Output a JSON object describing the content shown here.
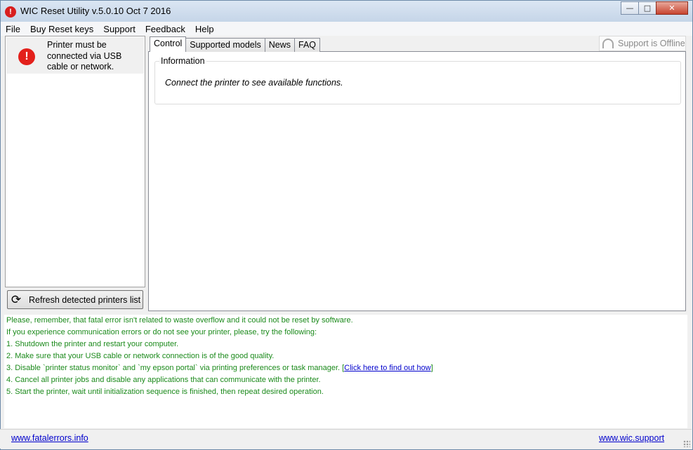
{
  "window": {
    "title": "WIC Reset Utility v.5.0.10 Oct  7 2016",
    "app_icon": "!"
  },
  "title_buttons": {
    "minimize": "—",
    "maximize": "□",
    "close": "✕"
  },
  "menu": [
    "File",
    "Buy Reset keys",
    "Support",
    "Feedback",
    "Help"
  ],
  "left_panel": {
    "message": "Printer must be connected via USB cable or network.",
    "error_icon": "!",
    "refresh_button": "Refresh detected printers list",
    "refresh_icon": "⟳"
  },
  "tabs": [
    "Control",
    "Supported models",
    "News",
    "FAQ"
  ],
  "support_status": "Support is Offline",
  "info_group": {
    "legend": "Information",
    "text": "Connect the printer to see available functions."
  },
  "log": {
    "line1": "Please, remember, that fatal error isn't related to waste overflow and it could not be reset by software.",
    "line2": "If you experience communication errors or do not see your printer, please, try the following:",
    "line3": "1. Shutdown the printer and restart your computer.",
    "line4": "2. Make sure that your USB cable or network connection is of the good quality.",
    "line5": "3. Disable `printer status monitor` and `my epson portal` via printing preferences or task manager. [",
    "line5_link": "Click here to find out how",
    "line5_end": "]",
    "line6": "4. Cancel all printer jobs and disable any applications that can communicate with the printer.",
    "line7": "5. Start the printer, wait until initialization sequence is finished, then repeat desired operation."
  },
  "status": {
    "left_link": "www.fatalerrors.info",
    "right_link": "www.wic.support"
  },
  "colors": {
    "log_text": "#1b8a1b",
    "link": "#0000cc",
    "error": "#e3201b"
  }
}
